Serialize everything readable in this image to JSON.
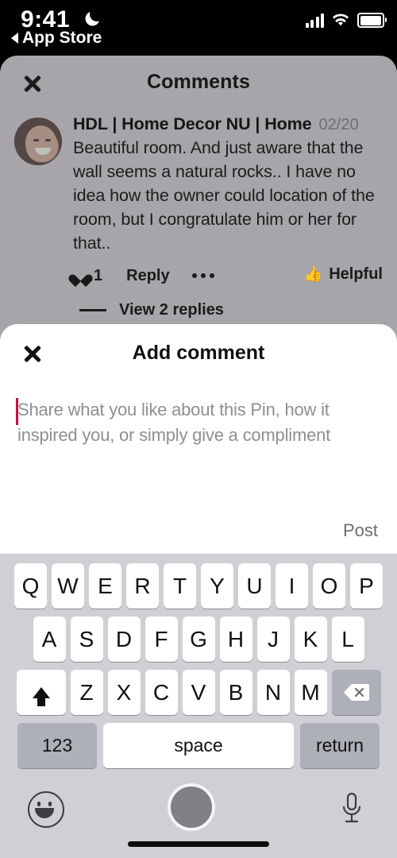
{
  "status_bar": {
    "time": "9:41",
    "dnd_icon": "crescent-moon-icon",
    "back_label": "App Store",
    "signal_icon": "cellular-signal-icon",
    "wifi_icon": "wifi-icon",
    "battery_icon": "battery-icon"
  },
  "comments_sheet": {
    "title": "Comments",
    "close_icon": "close-icon",
    "comment": {
      "username": "HDL | Home Decor NU | Home",
      "date": "02/20",
      "text": "Beautiful room. And just aware that the wall seems a natural rocks.. I have no idea how the owner could location of the room, but I congratulate him or her for that..",
      "like_icon": "heart-icon",
      "like_count": "1",
      "reply_label": "Reply",
      "more_icon": "ellipsis-icon",
      "helpful_icon": "thumbs-up-icon",
      "helpful_label": "Helpful",
      "view_replies_label": "View 2 replies"
    }
  },
  "add_comment_sheet": {
    "title": "Add comment",
    "close_icon": "close-icon",
    "input_value": "",
    "input_placeholder": "Share what you like about this Pin, how it inspired you, or simply give a compliment",
    "post_label": "Post",
    "caret_color": "#c9103f"
  },
  "keyboard": {
    "row1": [
      "Q",
      "W",
      "E",
      "R",
      "T",
      "Y",
      "U",
      "I",
      "O",
      "P"
    ],
    "row2": [
      "A",
      "S",
      "D",
      "F",
      "G",
      "H",
      "J",
      "K",
      "L"
    ],
    "row3_letters": [
      "Z",
      "X",
      "C",
      "V",
      "B",
      "N",
      "M"
    ],
    "shift_icon": "shift-arrow-icon",
    "backspace_icon": "backspace-icon",
    "numbers_label": "123",
    "space_label": "space",
    "return_label": "return",
    "emoji_icon": "smiley-face-icon",
    "mic_icon": "microphone-icon",
    "touch_indicator": "touch-point-indicator",
    "home_indicator": "home-indicator"
  }
}
